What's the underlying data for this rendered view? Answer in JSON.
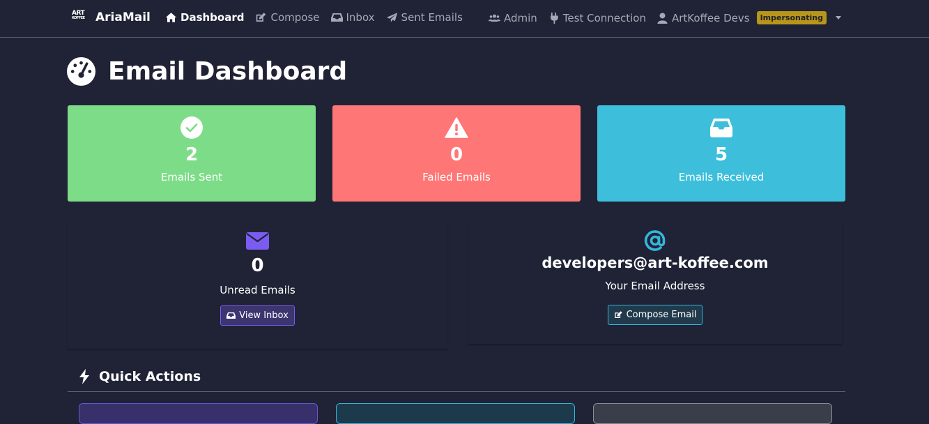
{
  "app": {
    "logo_text_top": "ART",
    "logo_text_bottom": "KOFFEE",
    "name": "AriaMail"
  },
  "nav": {
    "items": [
      {
        "label": "Dashboard",
        "icon": "home-icon",
        "active": true
      },
      {
        "label": "Compose",
        "icon": "edit-icon",
        "active": false
      },
      {
        "label": "Inbox",
        "icon": "inbox-icon",
        "active": false
      },
      {
        "label": "Sent Emails",
        "icon": "paper-plane-icon",
        "active": false
      }
    ],
    "right": {
      "admin": "Admin",
      "test_connection": "Test Connection",
      "user": "ArtKoffee Devs",
      "badge": "Impersonating"
    }
  },
  "page": {
    "title": "Email Dashboard",
    "icon": "gauge-icon"
  },
  "stats": [
    {
      "value": "2",
      "label": "Emails Sent",
      "icon": "check-circle-icon",
      "color": "#7ddc88"
    },
    {
      "value": "0",
      "label": "Failed Emails",
      "icon": "warning-icon",
      "color": "#ff7676"
    },
    {
      "value": "5",
      "label": "Emails Received",
      "icon": "inbox-icon",
      "color": "#3dbfdc"
    }
  ],
  "unread": {
    "value": "0",
    "label": "Unread Emails",
    "button": "View Inbox",
    "icon": "envelope-icon",
    "color": "#7b5cf0"
  },
  "address": {
    "email": "developers@art-koffee.com",
    "label": "Your Email Address",
    "button": "Compose Email",
    "icon": "at-icon",
    "color": "#35b6dc"
  },
  "quick_actions": {
    "title": "Quick Actions",
    "icon": "bolt-icon"
  },
  "colors": {
    "background": "#1f2335",
    "nav_muted": "#a6a9b5",
    "badge": "#b8961a"
  }
}
